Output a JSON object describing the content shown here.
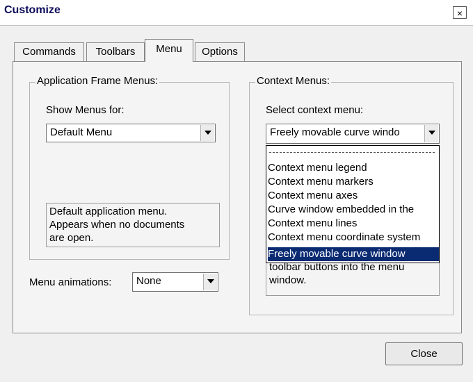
{
  "window": {
    "title": "Customize",
    "close_glyph": "×"
  },
  "tabs": [
    {
      "label": "Commands"
    },
    {
      "label": "Toolbars"
    },
    {
      "label": "Menu"
    },
    {
      "label": "Options"
    }
  ],
  "app_frame": {
    "legend": "Application Frame Menus:",
    "show_label": "Show Menus for:",
    "combo_value": "Default Menu",
    "description": [
      "Default application menu.",
      "Appears when no documents",
      "are open."
    ]
  },
  "animations": {
    "label": "Menu animations:",
    "value": "None"
  },
  "context": {
    "legend": "Context Menus:",
    "select_label": "Select context menu:",
    "combo_value": "Freely movable curve windo",
    "items": [
      "Context menu legend",
      "Context menu markers",
      "Context menu axes",
      "Curve window embedded in the",
      "Context menu lines",
      "Context menu coordinate system",
      "Freely movable curve window"
    ],
    "selected_index": 6,
    "hint_partial": [
      "toolbar buttons into the menu",
      "window."
    ]
  },
  "footer": {
    "close_label": "Close"
  },
  "colors": {
    "selection": "#0a2a72",
    "title_text": "#0a0a5a"
  }
}
